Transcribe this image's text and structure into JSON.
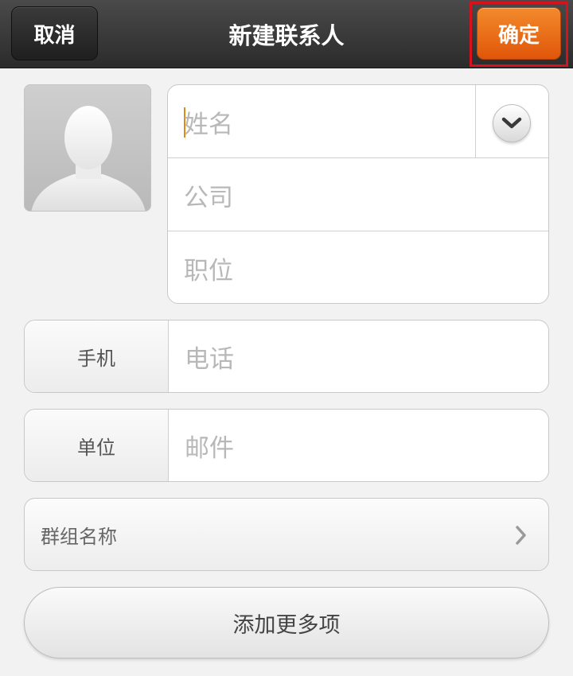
{
  "header": {
    "cancel_label": "取消",
    "title": "新建联系人",
    "confirm_label": "确定"
  },
  "identity": {
    "name_placeholder": "姓名",
    "company_placeholder": "公司",
    "title_placeholder": "职位",
    "expand_icon": "chevron-down-icon",
    "avatar_icon": "default-avatar-silhouette"
  },
  "fields": {
    "phone": {
      "type_label": "手机",
      "placeholder": "电话"
    },
    "email": {
      "type_label": "单位",
      "placeholder": "邮件"
    }
  },
  "group": {
    "label": "群组名称",
    "icon": "chevron-right-icon"
  },
  "actions": {
    "add_more_label": "添加更多项"
  },
  "colors": {
    "confirm_accent": "#e86a14",
    "highlight_frame": "#d8121c",
    "caret": "#e08a12"
  }
}
